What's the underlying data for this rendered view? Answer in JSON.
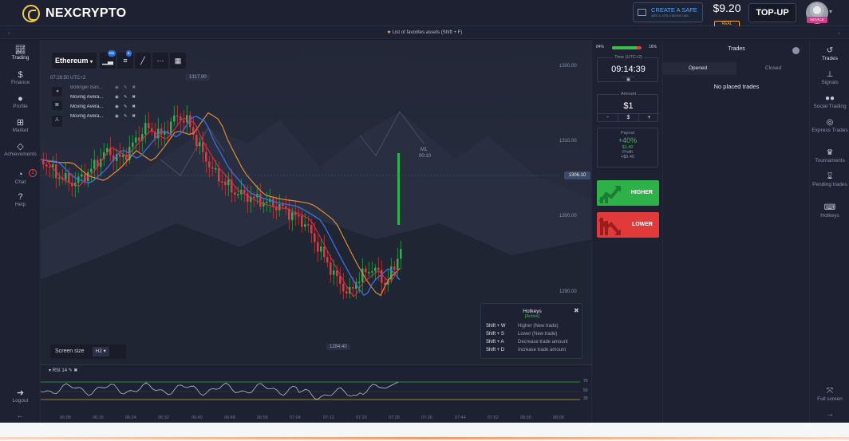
{
  "brand": {
    "name": "NEXCRYPTO",
    "primary": "#f2c94c"
  },
  "header": {
    "safe_title": "CREATE A SAFE",
    "safe_sub": "with a 10% interest rate",
    "balance": "$9.20",
    "balance_tag": "REAL",
    "topup": "TOP-UP",
    "avatar_badge": "NOVICE"
  },
  "favorites": {
    "text": "List of favorites assets (Shift + F)"
  },
  "left_nav": [
    {
      "label": "Trading",
      "icon": "chart-icon"
    },
    {
      "label": "Finance",
      "icon": "dollar-icon"
    },
    {
      "label": "Profile",
      "icon": "user-icon"
    },
    {
      "label": "Market",
      "icon": "cart-icon"
    },
    {
      "label": "Achievements",
      "icon": "diamond-icon"
    },
    {
      "label": "Chat",
      "icon": "chat-icon",
      "badge": "1"
    },
    {
      "label": "Help",
      "icon": "help-icon"
    }
  ],
  "left_bottom": {
    "logout": "Logout"
  },
  "chart": {
    "asset": "Ethereum",
    "time_label": "07:28:50 UTC+2",
    "toolbar_badge_1": "M1",
    "toolbar_badge_2": "5",
    "indicators": [
      "Bollinger Ban...",
      "Moving Avera...",
      "Moving Avera...",
      "Moving Avera..."
    ],
    "current_price": "1306.10",
    "high_label": "1317.90",
    "low_label": "1284.40",
    "m1_label": "M1",
    "countdown": "00:10",
    "screen_size_label": "Screen size",
    "screen_size_value": "H2"
  },
  "chart_data": {
    "type": "candlestick",
    "title": "",
    "y_ticks": [
      1300,
      1310,
      1300,
      1290
    ],
    "y_tick_labels": [
      "1300.00",
      "1310.00",
      "1300.00",
      "1290.00"
    ],
    "x_ticks": [
      "06:08",
      "06:16",
      "06:24",
      "06:32",
      "06:40",
      "06:48",
      "06:56",
      "07:04",
      "07:12",
      "07:20",
      "07:28",
      "07:36",
      "07:44",
      "07:52",
      "08:00",
      "08:08"
    ],
    "annotations": [
      {
        "text": "1317.90"
      },
      {
        "text": "1284.40"
      },
      {
        "text": "1306.10"
      }
    ]
  },
  "hotkeys": {
    "title": "Hotkeys",
    "status": "[Active]",
    "rows": [
      {
        "key": "Shift + W",
        "desc": "Higher (New trade)"
      },
      {
        "key": "Shift + S",
        "desc": "Lower (New trade)"
      },
      {
        "key": "Shift + A",
        "desc": "Decrease trade amount"
      },
      {
        "key": "Shift + D",
        "desc": "Increase trade amount"
      }
    ]
  },
  "rsi": {
    "label": "RSI 14",
    "levels": [
      "70",
      "50",
      "30"
    ]
  },
  "trade": {
    "pct_left": "84%",
    "pct_right": "16%",
    "pct_value": 0.84,
    "time_caption": "Time (UTC+2)",
    "time_value": "09:14:39",
    "amount_caption": "Amount",
    "amount_value": "$1",
    "amount_minus": "-",
    "amount_symbol": "$",
    "amount_plus": "+",
    "payout_caption": "Payout",
    "payout_pct": "+40%",
    "payout_amt": "$1.40",
    "profit_caption": "Profit",
    "profit_amt": "+$0.40",
    "higher": "HIGHER",
    "lower": "LOWER"
  },
  "trades": {
    "title": "Trades",
    "tab_opened": "Opened",
    "tab_closed": "Closed",
    "empty": "No placed trades"
  },
  "right_nav": [
    {
      "label": "Trades",
      "icon": "history-icon"
    },
    {
      "label": "Signals",
      "icon": "signal-icon"
    },
    {
      "label": "Social Trading",
      "icon": "users-icon"
    },
    {
      "label": "Express Trades",
      "icon": "express-icon"
    },
    {
      "label": "Tournaments",
      "icon": "trophy-icon"
    },
    {
      "label": "Pending trades",
      "icon": "hourglass-icon"
    },
    {
      "label": "Hotkeys",
      "icon": "keyboard-icon"
    }
  ],
  "right_bottom": {
    "fullscreen": "Full screen"
  },
  "colors": {
    "up": "#2fb14a",
    "down": "#e03a3a",
    "ma_blue": "#3b6fe0",
    "ma_orange": "#e08a3a",
    "ma_red": "#e0304a"
  }
}
